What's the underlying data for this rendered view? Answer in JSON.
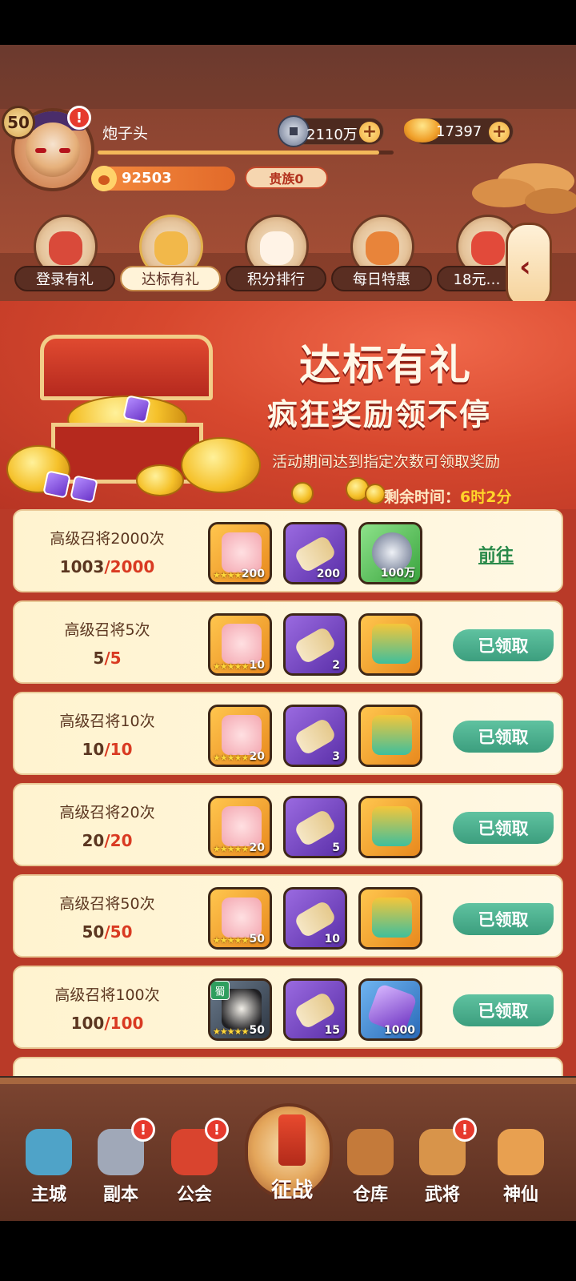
{
  "header": {
    "level": "50",
    "player_name": "炮子头",
    "power": "92503",
    "noble": "贵族0",
    "exp_fraction": 0.95,
    "silver": "2110万",
    "gold": "17397",
    "plus": "+",
    "avatar_alert": "!"
  },
  "tabs": [
    {
      "label": "登录有礼",
      "icon": "gift-bag-icon"
    },
    {
      "label": "达标有礼",
      "icon": "treasure-chest-icon",
      "active": true
    },
    {
      "label": "积分排行",
      "icon": "lucky-cat-icon"
    },
    {
      "label": "每日特惠",
      "icon": "money-bag-icon"
    },
    {
      "label": "18元…",
      "icon": "gift-box-icon"
    }
  ],
  "side_toggle": "‹",
  "banner": {
    "title": "达标有礼",
    "subtitle": "疯狂奖励领不停",
    "description": "活动期间达到指定次数可领取奖励",
    "countdown_label": "剩余时间：",
    "countdown_value": "6时2分"
  },
  "rows": [
    {
      "title": "高级召将2000次",
      "current": "1003",
      "target": "/2000",
      "action": "前往",
      "items": [
        {
          "type": "puzzle",
          "color": "gold",
          "qty": "200",
          "stars": "★★★★★"
        },
        {
          "type": "scroll",
          "color": "purple",
          "qty": "200"
        },
        {
          "type": "coin",
          "color": "green",
          "qty": "100万"
        }
      ]
    },
    {
      "title": "高级召将5次",
      "current": "5",
      "target": "/5",
      "action": "已领取",
      "items": [
        {
          "type": "puzzle",
          "color": "gold",
          "qty": "10",
          "stars": "★★★★★"
        },
        {
          "type": "scroll",
          "color": "purple",
          "qty": "2"
        },
        {
          "type": "box",
          "color": "gold",
          "qty": ""
        }
      ]
    },
    {
      "title": "高级召将10次",
      "current": "10",
      "target": "/10",
      "action": "已领取",
      "items": [
        {
          "type": "puzzle",
          "color": "gold",
          "qty": "20",
          "stars": "★★★★★"
        },
        {
          "type": "scroll",
          "color": "purple",
          "qty": "3"
        },
        {
          "type": "box",
          "color": "gold",
          "qty": ""
        }
      ]
    },
    {
      "title": "高级召将20次",
      "current": "20",
      "target": "/20",
      "action": "已领取",
      "items": [
        {
          "type": "puzzle",
          "color": "gold",
          "qty": "20",
          "stars": "★★★★★"
        },
        {
          "type": "scroll",
          "color": "purple",
          "qty": "5"
        },
        {
          "type": "box",
          "color": "gold",
          "qty": ""
        }
      ]
    },
    {
      "title": "高级召将50次",
      "current": "50",
      "target": "/50",
      "action": "已领取",
      "items": [
        {
          "type": "puzzle",
          "color": "gold",
          "qty": "50",
          "stars": "★★★★★"
        },
        {
          "type": "scroll",
          "color": "purple",
          "qty": "10"
        },
        {
          "type": "box",
          "color": "gold",
          "qty": ""
        }
      ]
    },
    {
      "title": "高级召将100次",
      "current": "100",
      "target": "/100",
      "action": "已领取",
      "items": [
        {
          "type": "hero",
          "color": "gold",
          "qty": "50",
          "stars": "★★★★★",
          "faction": "蜀"
        },
        {
          "type": "scroll",
          "color": "purple",
          "qty": "15"
        },
        {
          "type": "crystal",
          "color": "blue",
          "qty": "1000"
        }
      ]
    }
  ],
  "nav": {
    "items": [
      {
        "label": "主城",
        "icon": "city-icon",
        "color": "#4fa3c8",
        "alert": ""
      },
      {
        "label": "副本",
        "icon": "sword-icon",
        "color": "#a0a8b8",
        "alert": "!"
      },
      {
        "label": "公会",
        "icon": "flag-icon",
        "color": "#d9442e",
        "alert": "!"
      },
      {
        "label": "仓库",
        "icon": "treasure-bag-icon",
        "color": "#c47a3a",
        "alert": ""
      },
      {
        "label": "武将",
        "icon": "cat-hero-icon",
        "color": "#d8944a",
        "alert": "!"
      },
      {
        "label": "神仙",
        "icon": "cat-face-icon",
        "color": "#e8a050",
        "alert": ""
      }
    ],
    "battle_label": "征战"
  }
}
